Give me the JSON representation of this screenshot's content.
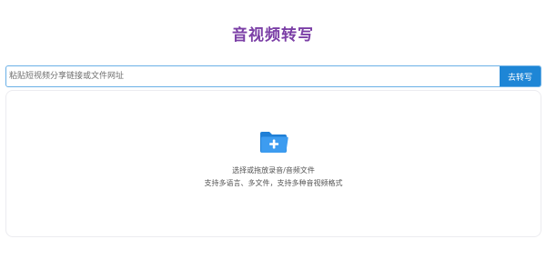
{
  "header": {
    "title": "音视频转写"
  },
  "url_bar": {
    "placeholder": "粘贴短视频分享链接或文件网址",
    "value": "",
    "button_label": "去转写"
  },
  "upload": {
    "icon": "folder-plus-icon",
    "line1": "选择或拖放录音/音频文件",
    "line2": "支持多语言、多文件，支持多种音视频格式"
  },
  "colors": {
    "title": "#7b3fa6",
    "accent": "#1e86d6",
    "input_border": "#6ab0e6",
    "folder_icon": "#2a8ee6"
  }
}
